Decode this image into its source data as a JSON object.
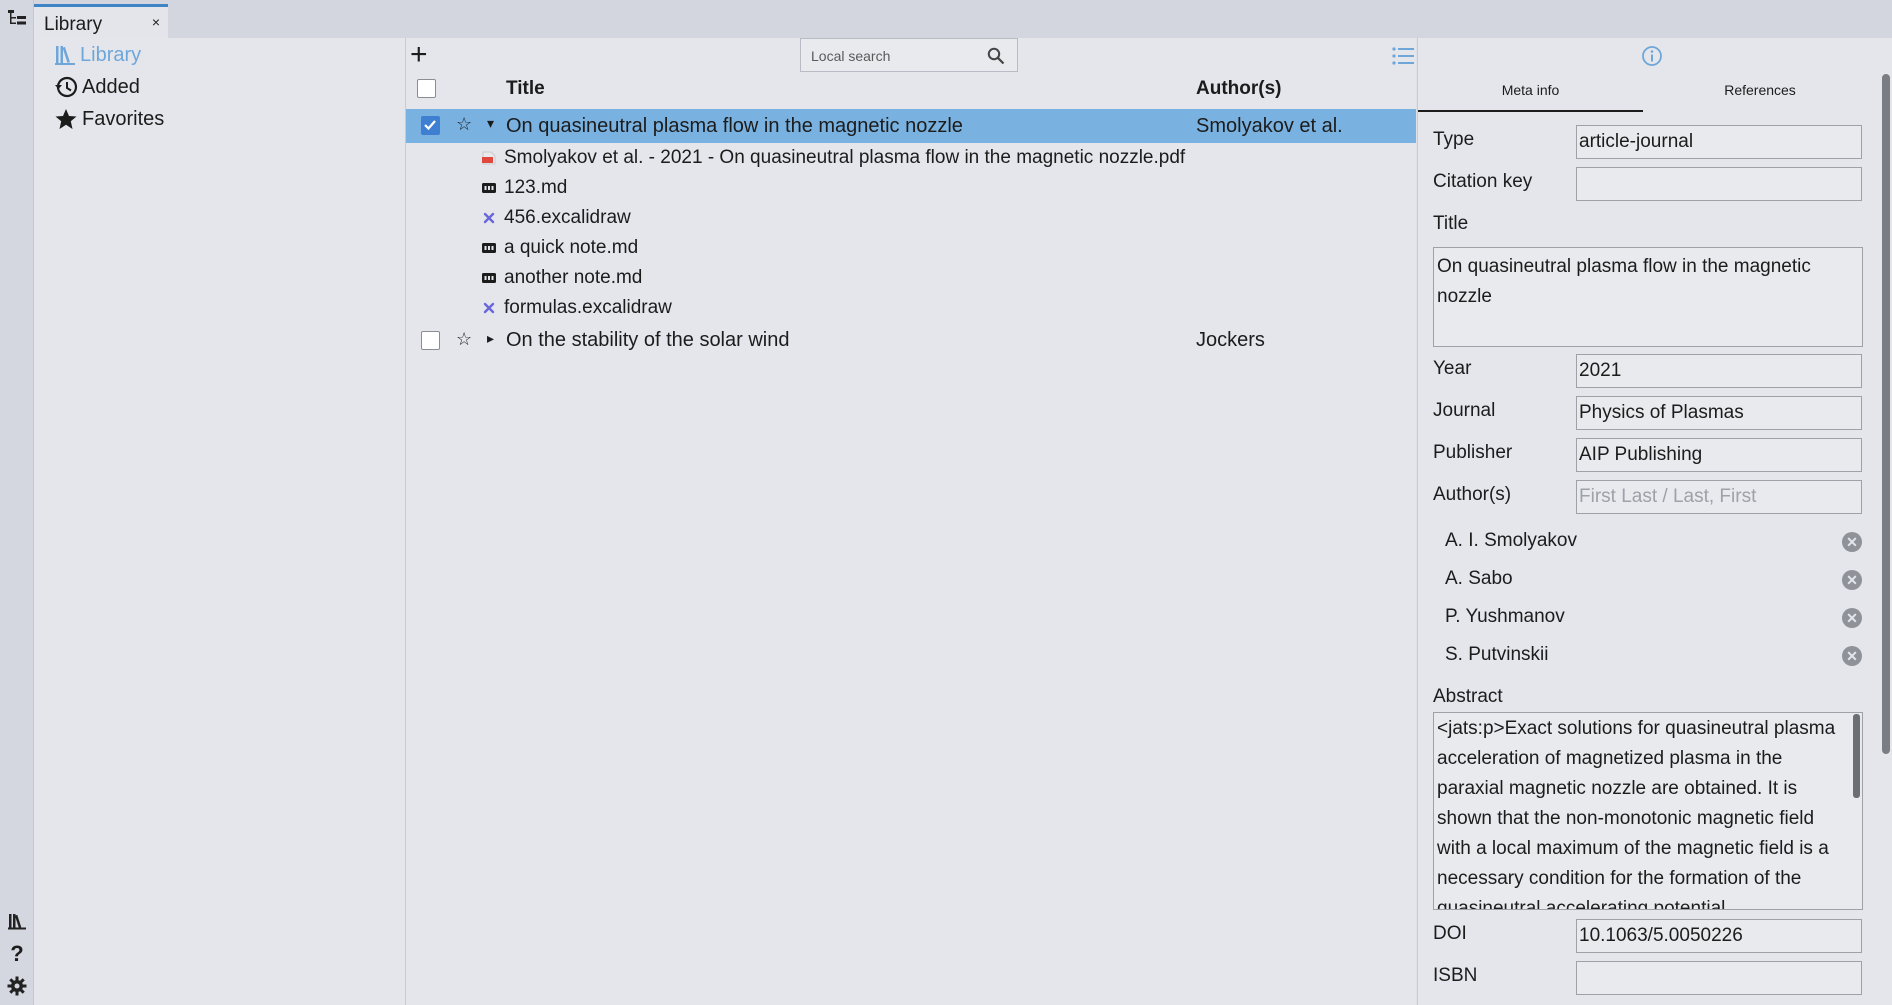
{
  "tab": {
    "label": "Library",
    "close": "×"
  },
  "sidebar": {
    "items": [
      {
        "label": "Library",
        "icon": "library-icon",
        "active": true
      },
      {
        "label": "Added",
        "icon": "history-icon"
      },
      {
        "label": "Favorites",
        "icon": "star-icon"
      }
    ]
  },
  "list": {
    "add_label": "+",
    "search_placeholder": "Local search",
    "columns": {
      "title": "Title",
      "authors": "Author(s)"
    },
    "rows": [
      {
        "title": "On quasineutral plasma flow in the magnetic nozzle",
        "authors": "Smolyakov et al.",
        "checked": true,
        "expanded": true,
        "star": "☆",
        "caret": "▾"
      },
      {
        "title": "On the stability of the solar wind",
        "authors": "Jockers",
        "checked": false,
        "expanded": false,
        "star": "☆",
        "caret": "▸"
      }
    ],
    "files": [
      {
        "name": "Smolyakov et al. - 2021 - On quasineutral plasma flow in the magnetic nozzle.pdf",
        "icon": "pdf-icon"
      },
      {
        "name": "123.md",
        "icon": "markdown-icon"
      },
      {
        "name": "456.excalidraw",
        "icon": "excalidraw-icon"
      },
      {
        "name": "a quick note.md",
        "icon": "markdown-icon"
      },
      {
        "name": "another note.md",
        "icon": "markdown-icon"
      },
      {
        "name": "formulas.excalidraw",
        "icon": "excalidraw-icon"
      }
    ]
  },
  "details": {
    "tabs": {
      "meta": "Meta info",
      "refs": "References"
    },
    "labels": {
      "type": "Type",
      "citation_key": "Citation key",
      "title": "Title",
      "year": "Year",
      "journal": "Journal",
      "publisher": "Publisher",
      "authors": "Author(s)",
      "abstract": "Abstract",
      "doi": "DOI",
      "isbn": "ISBN"
    },
    "values": {
      "type": "article-journal",
      "citation_key": "",
      "title": "On quasineutral plasma flow in the magnetic nozzle",
      "year": "2021",
      "journal": "Physics of Plasmas",
      "publisher": "AIP Publishing",
      "authors_placeholder": "First Last / Last, First",
      "doi": "10.1063/5.0050226",
      "isbn": "",
      "abstract": "<jats:p>Exact solutions for quasineutral plasma acceleration of magnetized plasma in the paraxial magnetic nozzle are obtained. It is shown that the non-monotonic magnetic field with a local maximum of the magnetic field is a necessary condition for the formation of the quasineutral accelerating potential"
    },
    "authors": [
      "A. I. Smolyakov",
      "A. Sabo",
      "P. Yushmanov",
      "S. Putvinskii"
    ]
  },
  "colors": {
    "accent": "#3f85c6",
    "selection": "#79b2e0",
    "active_link": "#6fa6d9"
  }
}
